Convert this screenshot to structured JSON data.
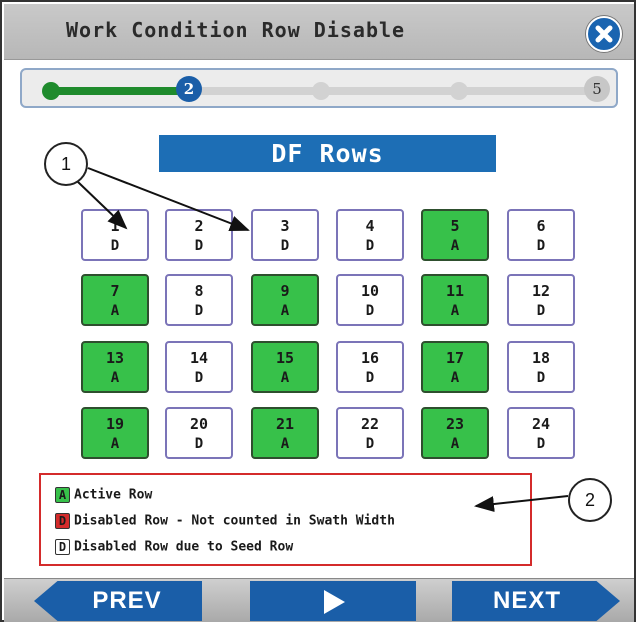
{
  "window": {
    "title": "Work Condition Row Disable",
    "close_icon": "close-icon"
  },
  "progress": {
    "current_step": "2",
    "last_step": "5",
    "total_steps": 5,
    "colors": {
      "done": "#1f8b2d",
      "current": "#1a5ea8",
      "pending": "#d2d2d2"
    }
  },
  "section_title": "DF Rows",
  "rows": [
    {
      "num": "1",
      "status": "D",
      "active": false
    },
    {
      "num": "2",
      "status": "D",
      "active": false
    },
    {
      "num": "3",
      "status": "D",
      "active": false
    },
    {
      "num": "4",
      "status": "D",
      "active": false
    },
    {
      "num": "5",
      "status": "A",
      "active": true
    },
    {
      "num": "6",
      "status": "D",
      "active": false
    },
    {
      "num": "7",
      "status": "A",
      "active": true
    },
    {
      "num": "8",
      "status": "D",
      "active": false
    },
    {
      "num": "9",
      "status": "A",
      "active": true
    },
    {
      "num": "10",
      "status": "D",
      "active": false
    },
    {
      "num": "11",
      "status": "A",
      "active": true
    },
    {
      "num": "12",
      "status": "D",
      "active": false
    },
    {
      "num": "13",
      "status": "A",
      "active": true
    },
    {
      "num": "14",
      "status": "D",
      "active": false
    },
    {
      "num": "15",
      "status": "A",
      "active": true
    },
    {
      "num": "16",
      "status": "D",
      "active": false
    },
    {
      "num": "17",
      "status": "A",
      "active": true
    },
    {
      "num": "18",
      "status": "D",
      "active": false
    },
    {
      "num": "19",
      "status": "A",
      "active": true
    },
    {
      "num": "20",
      "status": "D",
      "active": false
    },
    {
      "num": "21",
      "status": "A",
      "active": true
    },
    {
      "num": "22",
      "status": "D",
      "active": false
    },
    {
      "num": "23",
      "status": "A",
      "active": true
    },
    {
      "num": "24",
      "status": "D",
      "active": false
    }
  ],
  "legend": [
    {
      "key": "A",
      "color": "#37c14a",
      "label": "Active Row"
    },
    {
      "key": "D",
      "color": "#d42b2b",
      "label": "Disabled Row - Not counted in Swath Width"
    },
    {
      "key": "D",
      "color": "#ffffff",
      "label": "Disabled Row due to Seed Row"
    }
  ],
  "callouts": [
    "1",
    "2"
  ],
  "nav": {
    "prev_label": "PREV",
    "play_icon": "play-icon",
    "next_label": "NEXT"
  },
  "accent_color": "#1a5ea8"
}
